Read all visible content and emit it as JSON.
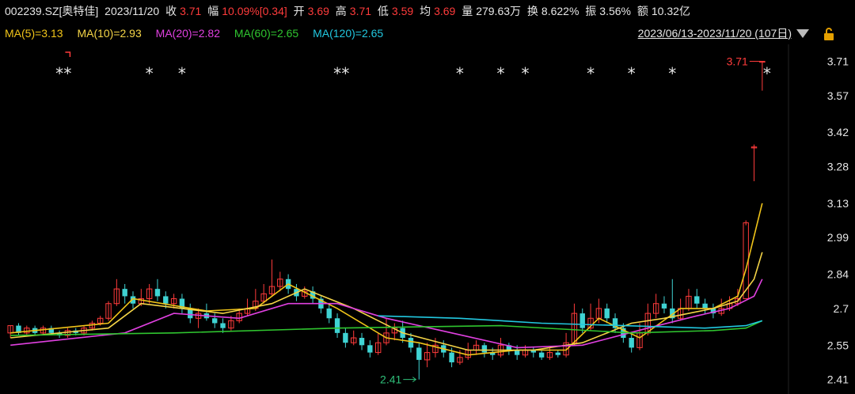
{
  "header": {
    "code": "002239.SZ[奥特佳]",
    "date": "2023/11/20",
    "close_label": "收",
    "close_value": "3.71",
    "change_label": "幅",
    "change_value": "10.09%[0.34]",
    "open_label": "开",
    "open_value": "3.69",
    "high_label": "高",
    "high_value": "3.71",
    "low_label": "低",
    "low_value": "3.59",
    "avg_label": "均",
    "avg_value": "3.69",
    "vol_label": "量",
    "vol_value": "279.63万",
    "turnover_label": "换",
    "turnover_value": "8.622%",
    "amplitude_label": "振",
    "amplitude_value": "3.56%",
    "amount_label": "额",
    "amount_value": "10.32亿"
  },
  "ma_bar": {
    "ma5": "MA(5)=3.13",
    "ma10": "MA(10)=2.93",
    "ma20": "MA(20)=2.82",
    "ma60": "MA(60)=2.65",
    "ma120": "MA(120)=2.65",
    "range": "2023/06/13-2023/11/20 (107日)"
  },
  "icons": {
    "dropdown": "triangle-down-icon",
    "lock": "lock-icon"
  },
  "colors": {
    "up": "#ff3b3b",
    "down": "#3fd3d3",
    "ma5": "#f0c419",
    "ma10": "#f5d547",
    "ma20": "#e040e0",
    "ma60": "#2fc52f",
    "ma120": "#22c8e0",
    "annotation_high": "#ff3b3b",
    "annotation_low": "#2fc07a"
  },
  "chart_data": {
    "type": "candlestick",
    "ylim": [
      2.37,
      3.76
    ],
    "yticks": [
      "3.71",
      "3.57",
      "3.42",
      "3.28",
      "3.13",
      "2.99",
      "2.84",
      "2.7",
      "2.55",
      "2.41"
    ],
    "annotation_high": "3.71",
    "annotation_low": "2.41",
    "candles": [
      [
        2.6,
        2.63,
        2.63,
        2.58
      ],
      [
        2.63,
        2.6,
        2.64,
        2.59
      ],
      [
        2.6,
        2.62,
        2.63,
        2.59
      ],
      [
        2.62,
        2.6,
        2.63,
        2.59
      ],
      [
        2.6,
        2.62,
        2.63,
        2.59
      ],
      [
        2.62,
        2.6,
        2.63,
        2.59
      ],
      [
        2.6,
        2.59,
        2.61,
        2.58
      ],
      [
        2.59,
        2.61,
        2.62,
        2.58
      ],
      [
        2.61,
        2.6,
        2.62,
        2.59
      ],
      [
        2.6,
        2.62,
        2.63,
        2.59
      ],
      [
        2.62,
        2.64,
        2.65,
        2.61
      ],
      [
        2.64,
        2.66,
        2.67,
        2.63
      ],
      [
        2.66,
        2.72,
        2.73,
        2.65
      ],
      [
        2.72,
        2.78,
        2.82,
        2.71
      ],
      [
        2.78,
        2.75,
        2.8,
        2.72
      ],
      [
        2.75,
        2.72,
        2.77,
        2.7
      ],
      [
        2.72,
        2.74,
        2.78,
        2.71
      ],
      [
        2.74,
        2.78,
        2.8,
        2.72
      ],
      [
        2.78,
        2.75,
        2.82,
        2.73
      ],
      [
        2.75,
        2.72,
        2.77,
        2.7
      ],
      [
        2.72,
        2.74,
        2.76,
        2.7
      ],
      [
        2.74,
        2.7,
        2.76,
        2.68
      ],
      [
        2.7,
        2.66,
        2.72,
        2.64
      ],
      [
        2.66,
        2.68,
        2.7,
        2.62
      ],
      [
        2.68,
        2.66,
        2.72,
        2.65
      ],
      [
        2.66,
        2.64,
        2.68,
        2.62
      ],
      [
        2.64,
        2.62,
        2.66,
        2.6
      ],
      [
        2.62,
        2.65,
        2.67,
        2.61
      ],
      [
        2.65,
        2.68,
        2.7,
        2.64
      ],
      [
        2.68,
        2.7,
        2.74,
        2.67
      ],
      [
        2.7,
        2.73,
        2.78,
        2.69
      ],
      [
        2.73,
        2.76,
        2.8,
        2.72
      ],
      [
        2.76,
        2.79,
        2.9,
        2.75
      ],
      [
        2.79,
        2.82,
        2.85,
        2.77
      ],
      [
        2.82,
        2.78,
        2.84,
        2.76
      ],
      [
        2.78,
        2.75,
        2.8,
        2.73
      ],
      [
        2.75,
        2.77,
        2.79,
        2.74
      ],
      [
        2.77,
        2.74,
        2.79,
        2.72
      ],
      [
        2.74,
        2.7,
        2.75,
        2.68
      ],
      [
        2.7,
        2.66,
        2.72,
        2.64
      ],
      [
        2.66,
        2.6,
        2.68,
        2.58
      ],
      [
        2.6,
        2.56,
        2.62,
        2.54
      ],
      [
        2.56,
        2.58,
        2.61,
        2.55
      ],
      [
        2.58,
        2.55,
        2.6,
        2.53
      ],
      [
        2.55,
        2.52,
        2.57,
        2.5
      ],
      [
        2.52,
        2.56,
        2.6,
        2.51
      ],
      [
        2.56,
        2.6,
        2.66,
        2.55
      ],
      [
        2.6,
        2.62,
        2.64,
        2.57
      ],
      [
        2.62,
        2.58,
        2.65,
        2.56
      ],
      [
        2.58,
        2.54,
        2.6,
        2.52
      ],
      [
        2.54,
        2.49,
        2.56,
        2.41
      ],
      [
        2.49,
        2.52,
        2.56,
        2.46
      ],
      [
        2.52,
        2.55,
        2.58,
        2.5
      ],
      [
        2.55,
        2.52,
        2.57,
        2.5
      ],
      [
        2.52,
        2.48,
        2.54,
        2.46
      ],
      [
        2.48,
        2.5,
        2.53,
        2.47
      ],
      [
        2.5,
        2.53,
        2.56,
        2.49
      ],
      [
        2.53,
        2.55,
        2.57,
        2.51
      ],
      [
        2.55,
        2.52,
        2.56,
        2.5
      ],
      [
        2.52,
        2.51,
        2.54,
        2.49
      ],
      [
        2.51,
        2.55,
        2.58,
        2.5
      ],
      [
        2.55,
        2.53,
        2.56,
        2.51
      ],
      [
        2.53,
        2.51,
        2.55,
        2.49
      ],
      [
        2.51,
        2.53,
        2.55,
        2.5
      ],
      [
        2.53,
        2.52,
        2.54,
        2.5
      ],
      [
        2.52,
        2.5,
        2.53,
        2.49
      ],
      [
        2.5,
        2.52,
        2.54,
        2.49
      ],
      [
        2.52,
        2.51,
        2.53,
        2.5
      ],
      [
        2.51,
        2.56,
        2.6,
        2.5
      ],
      [
        2.56,
        2.68,
        2.72,
        2.55
      ],
      [
        2.68,
        2.62,
        2.7,
        2.6
      ],
      [
        2.62,
        2.66,
        2.72,
        2.61
      ],
      [
        2.66,
        2.7,
        2.74,
        2.64
      ],
      [
        2.7,
        2.66,
        2.72,
        2.64
      ],
      [
        2.66,
        2.62,
        2.68,
        2.6
      ],
      [
        2.62,
        2.58,
        2.64,
        2.56
      ],
      [
        2.58,
        2.54,
        2.6,
        2.52
      ],
      [
        2.54,
        2.6,
        2.64,
        2.53
      ],
      [
        2.6,
        2.68,
        2.72,
        2.59
      ],
      [
        2.68,
        2.72,
        2.76,
        2.66
      ],
      [
        2.72,
        2.7,
        2.75,
        2.68
      ],
      [
        2.7,
        2.66,
        2.82,
        2.64
      ],
      [
        2.66,
        2.7,
        2.74,
        2.65
      ],
      [
        2.7,
        2.75,
        2.78,
        2.69
      ],
      [
        2.75,
        2.72,
        2.78,
        2.7
      ],
      [
        2.72,
        2.7,
        2.74,
        2.68
      ],
      [
        2.7,
        2.68,
        2.72,
        2.66
      ],
      [
        2.68,
        2.7,
        2.74,
        2.67
      ],
      [
        2.7,
        2.72,
        2.75,
        2.69
      ],
      [
        2.72,
        2.74,
        2.78,
        2.71
      ],
      [
        2.74,
        3.05,
        3.06,
        3.04
      ],
      [
        3.36,
        3.36,
        3.37,
        3.22
      ],
      [
        3.71,
        3.71,
        3.71,
        3.59
      ]
    ],
    "ma_series": [
      {
        "name": "MA5",
        "points": [
          [
            0,
            2.6
          ],
          [
            12,
            2.64
          ],
          [
            15,
            2.74
          ],
          [
            24,
            2.69
          ],
          [
            30,
            2.7
          ],
          [
            34,
            2.8
          ],
          [
            40,
            2.7
          ],
          [
            46,
            2.58
          ],
          [
            50,
            2.56
          ],
          [
            56,
            2.51
          ],
          [
            62,
            2.53
          ],
          [
            68,
            2.53
          ],
          [
            72,
            2.66
          ],
          [
            77,
            2.58
          ],
          [
            82,
            2.7
          ],
          [
            86,
            2.7
          ],
          [
            89,
            2.75
          ],
          [
            90,
            2.86
          ],
          [
            92,
            3.13
          ]
        ]
      },
      {
        "name": "MA10",
        "points": [
          [
            0,
            2.58
          ],
          [
            12,
            2.62
          ],
          [
            16,
            2.72
          ],
          [
            26,
            2.68
          ],
          [
            32,
            2.72
          ],
          [
            36,
            2.78
          ],
          [
            42,
            2.7
          ],
          [
            48,
            2.6
          ],
          [
            56,
            2.53
          ],
          [
            64,
            2.53
          ],
          [
            70,
            2.56
          ],
          [
            76,
            2.64
          ],
          [
            80,
            2.66
          ],
          [
            86,
            2.7
          ],
          [
            89,
            2.73
          ],
          [
            91,
            2.82
          ],
          [
            92,
            2.93
          ]
        ]
      },
      {
        "name": "MA20",
        "points": [
          [
            0,
            2.55
          ],
          [
            14,
            2.6
          ],
          [
            20,
            2.68
          ],
          [
            28,
            2.66
          ],
          [
            34,
            2.72
          ],
          [
            40,
            2.72
          ],
          [
            46,
            2.66
          ],
          [
            54,
            2.6
          ],
          [
            62,
            2.54
          ],
          [
            70,
            2.55
          ],
          [
            78,
            2.62
          ],
          [
            84,
            2.67
          ],
          [
            88,
            2.7
          ],
          [
            91,
            2.75
          ],
          [
            92,
            2.82
          ]
        ]
      },
      {
        "name": "MA60",
        "points": [
          [
            0,
            2.59
          ],
          [
            20,
            2.6
          ],
          [
            40,
            2.62
          ],
          [
            60,
            2.63
          ],
          [
            76,
            2.6
          ],
          [
            86,
            2.61
          ],
          [
            90,
            2.62
          ],
          [
            92,
            2.65
          ]
        ]
      },
      {
        "name": "MA120",
        "points": [
          [
            45,
            2.67
          ],
          [
            55,
            2.66
          ],
          [
            65,
            2.64
          ],
          [
            75,
            2.63
          ],
          [
            85,
            2.62
          ],
          [
            90,
            2.63
          ],
          [
            92,
            2.65
          ]
        ]
      }
    ],
    "star_markers": [
      6,
      7,
      17,
      21,
      40,
      41,
      55,
      60,
      63,
      71,
      76,
      81
    ]
  }
}
